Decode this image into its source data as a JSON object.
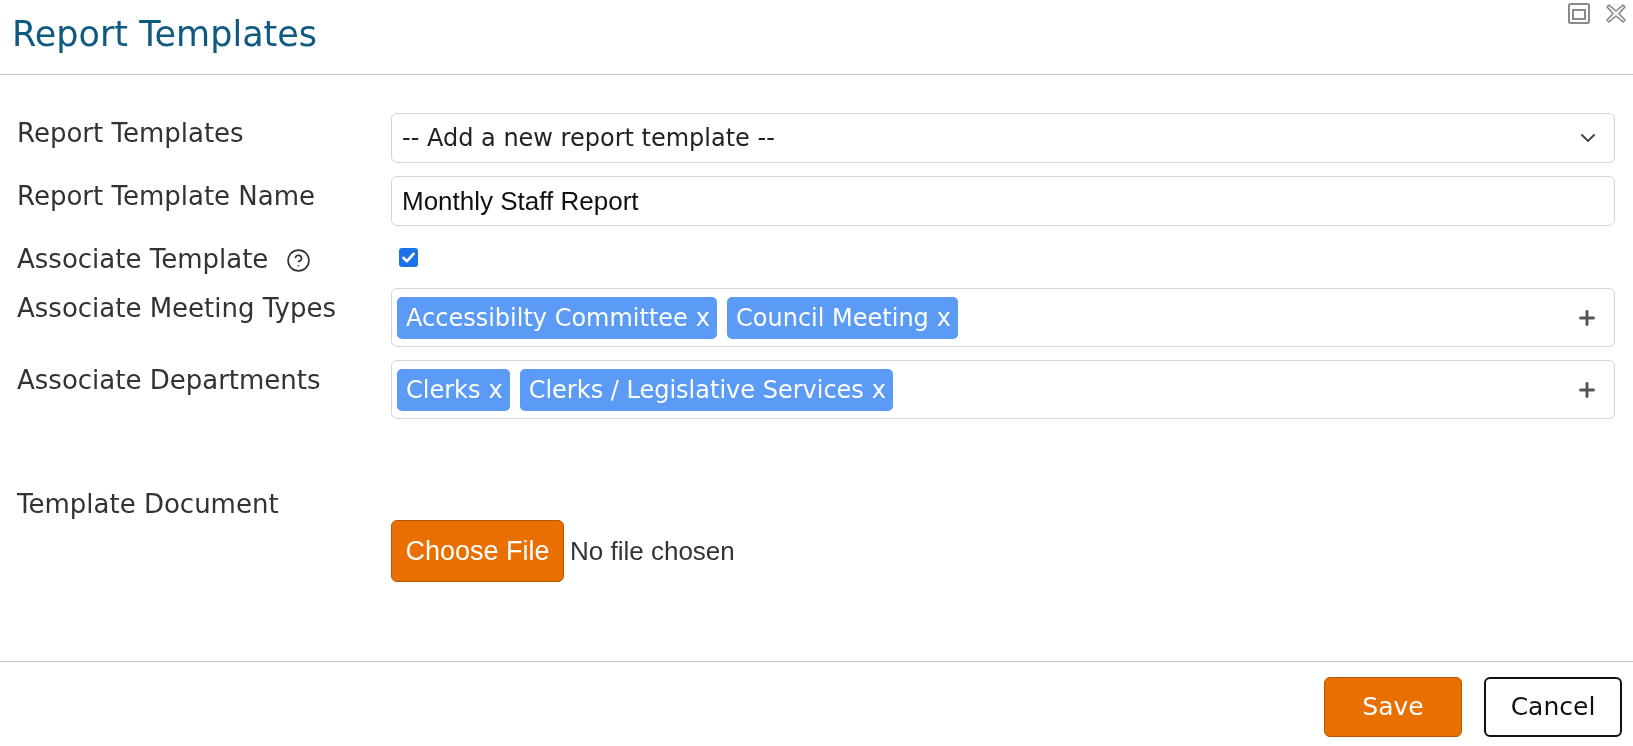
{
  "dialog": {
    "title": "Report Templates"
  },
  "fields": [
    {
      "kind": "select",
      "label": "Report Templates",
      "value": "-- Add a new report template --"
    },
    {
      "kind": "text",
      "label": "Report Template Name",
      "value": "Monthly Staff Report"
    },
    {
      "kind": "checkbox",
      "label": "Associate Template",
      "help": true,
      "checked": true
    },
    {
      "kind": "tags",
      "label": "Associate Meeting Types",
      "tags": [
        {
          "label": "Accessibilty Committee",
          "remove": "x"
        },
        {
          "label": "Council Meeting",
          "remove": "x"
        }
      ]
    },
    {
      "kind": "tags",
      "label": "Associate Departments",
      "tags": [
        {
          "label": "Clerks",
          "remove": "x"
        },
        {
          "label": "Clerks / Legislative Services",
          "remove": "x"
        }
      ]
    },
    {
      "kind": "file",
      "label": "Template Document",
      "button": "Choose File",
      "status": "No file chosen"
    }
  ],
  "footer": {
    "buttons": [
      {
        "kind": "primary",
        "label": "Save"
      },
      {
        "kind": "secondary",
        "label": "Cancel"
      }
    ]
  }
}
